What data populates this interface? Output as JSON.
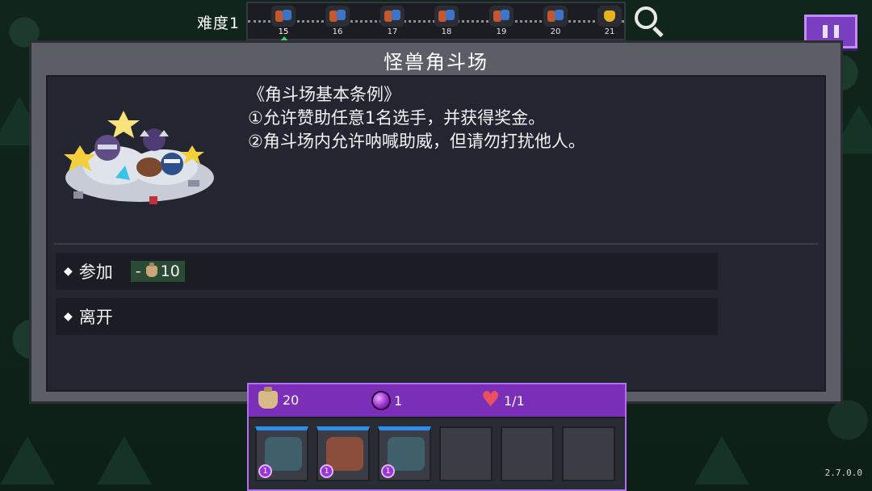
{
  "header": {
    "difficulty_label": "难度1",
    "stages": [
      {
        "number": "15",
        "current": true,
        "type": "battle"
      },
      {
        "number": "16",
        "current": false,
        "type": "battle"
      },
      {
        "number": "17",
        "current": false,
        "type": "battle"
      },
      {
        "number": "18",
        "current": false,
        "type": "battle"
      },
      {
        "number": "19",
        "current": false,
        "type": "battle"
      },
      {
        "number": "20",
        "current": false,
        "type": "battle"
      },
      {
        "number": "21",
        "current": false,
        "type": "trophy"
      }
    ],
    "search_icon": "magnifier-icon",
    "pause_icon": "pause-icon"
  },
  "event": {
    "title": "怪兽角斗场",
    "rules_heading": "《角斗场基本条例》",
    "rule_1": "①允许赞助任意1名选手，并获得奖金。",
    "rule_2": "②角斗场内允许呐喊助威，但请勿打扰他人。",
    "options": [
      {
        "label": "参加",
        "cost_sign": "-",
        "cost_value": "10",
        "cost_icon": "coin-bag-icon"
      },
      {
        "label": "离开"
      }
    ]
  },
  "inventory": {
    "gold": "20",
    "gems": "1",
    "hearts": "1/1",
    "slots": [
      {
        "filled": true,
        "level": "1",
        "creature": "tree-stump-monster"
      },
      {
        "filled": true,
        "level": "1",
        "creature": "boar-monster"
      },
      {
        "filled": true,
        "level": "1",
        "creature": "tree-stump-monster"
      },
      {
        "filled": false
      },
      {
        "filled": false
      },
      {
        "filled": false
      }
    ]
  },
  "version": "2.7.0.0",
  "colors": {
    "accent_purple": "#7b2fb8",
    "panel_gray": "#5b5e66",
    "panel_dark": "#232630",
    "cost_green": "#2b4b34",
    "slot_blue": "#2f8ee8"
  }
}
